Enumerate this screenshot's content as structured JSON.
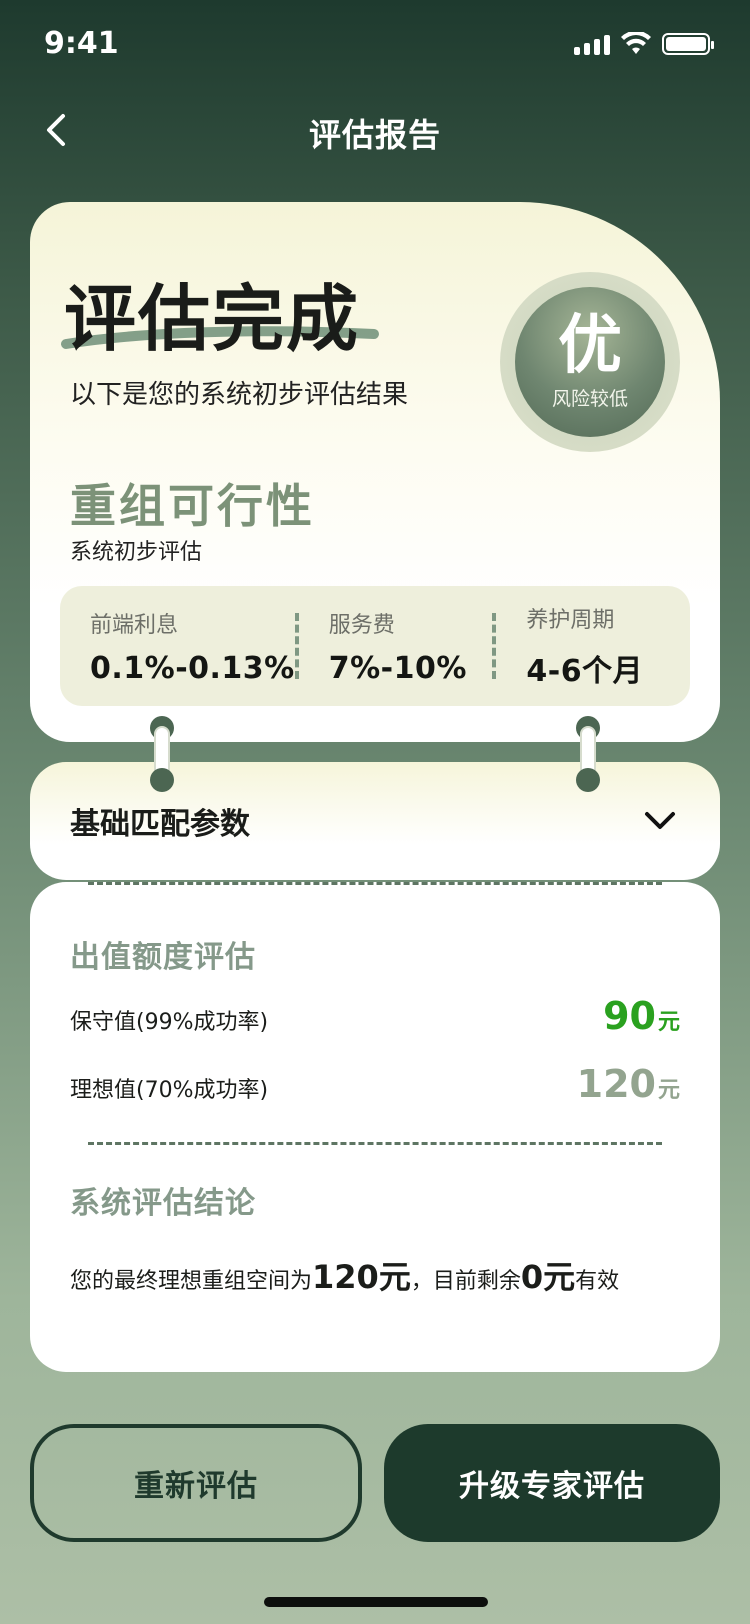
{
  "status_bar": {
    "time": "9:41"
  },
  "nav": {
    "title": "评估报告"
  },
  "hero": {
    "title": "评估完成",
    "subtitle": "以下是您的系统初步评估结果",
    "grade": {
      "letter": "优",
      "label": "风险较低"
    }
  },
  "feasibility": {
    "title": "重组可行性",
    "subtitle": "系统初步评估",
    "metrics": [
      {
        "label": "前端利息",
        "value": "0.1%-0.13%"
      },
      {
        "label": "服务费",
        "value": "7%-10%"
      },
      {
        "label": "养护周期",
        "value": "4-6个月"
      }
    ]
  },
  "accordion": {
    "title": "基础匹配参数"
  },
  "quota": {
    "title": "出值额度评估",
    "rows": [
      {
        "label": "保守值(99%成功率)",
        "value": "90",
        "unit": "元"
      },
      {
        "label": "理想值(70%成功率)",
        "value": "120",
        "unit": "元"
      }
    ],
    "colors": {
      "conservative": "#2aa11f",
      "ideal": "#93a48f"
    }
  },
  "conclusion": {
    "title": "系统评估结论",
    "text_1": "您的最终理想重组空间为",
    "amount_1": "120元",
    "text_2": "，目前剩余",
    "amount_2": "0元",
    "text_3": "有效"
  },
  "buttons": {
    "retry": "重新评估",
    "upgrade": "升级专家评估"
  },
  "icons": [
    "back-arrow-icon",
    "signal-icon",
    "wifi-icon",
    "battery-icon",
    "chevron-down-icon"
  ]
}
